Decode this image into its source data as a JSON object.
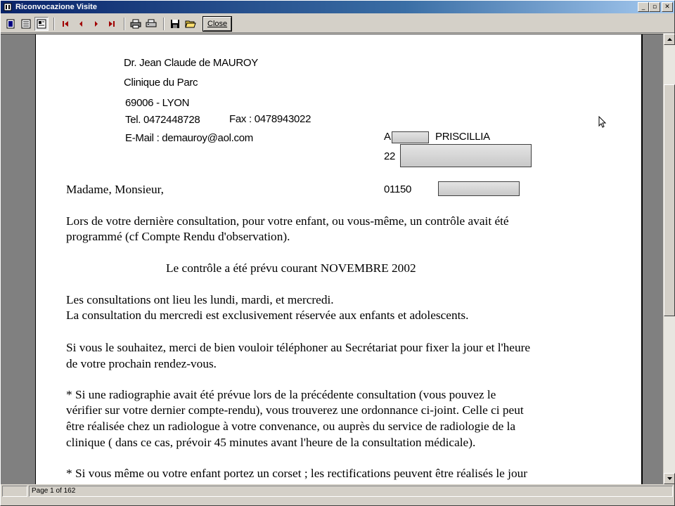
{
  "window": {
    "title": "Riconvocazione Visite"
  },
  "titlebar_buttons": {
    "minimize": "_",
    "restore": "▫",
    "close": "✕"
  },
  "toolbar": {
    "close_label": "Close"
  },
  "letterhead": {
    "doctor": "Dr. Jean Claude de MAUROY",
    "clinic": "Clinique du Parc",
    "city": "69006 - LYON",
    "tel": "Tel. 0472448728",
    "fax": "Fax : 0478943022",
    "email": "E-Mail : demauroy@aol.com"
  },
  "recipient": {
    "name_initial": "A",
    "name": "PRISCILLIA",
    "street_no": "22",
    "zip": "01150"
  },
  "letter": {
    "salutation": "Madame, Monsieur,",
    "p1_l1": "Lors de votre dernière consultation, pour votre enfant, ou vous-même, un contrôle avait été",
    "p1_l2": "programmé (cf Compte Rendu d'observation).",
    "centered": "Le contrôle a été prévu courant NOVEMBRE 2002",
    "p2_l1": "Les consultations ont lieu les lundi, mardi, et mercredi.",
    "p2_l2": "La consultation du mercredi est exclusivement réservée aux enfants et adolescents.",
    "p3_l1": "Si vous le souhaitez, merci de bien vouloir téléphoner au Secrétariat pour fixer la jour et l'heure",
    "p3_l2": "de votre prochain rendez-vous.",
    "p4_l1": "* Si une radiographie avait été prévue lors de la précédente consultation (vous pouvez le",
    "p4_l2": "vérifier sur votre dernier compte-rendu), vous trouverez une ordonnance ci-joint. Celle ci peut",
    "p4_l3": "être réalisée chez un radiologue à votre convenance, ou auprès du service de radiologie de la",
    "p4_l4": "clinique ( dans ce cas, prévoir 45 minutes avant l'heure de la consultation médicale).",
    "p5_l1": "* Si vous même ou votre enfant portez un corset ; les rectifications peuvent être réalisés le jour"
  },
  "status": {
    "page_info": "Page 1 of 162"
  }
}
